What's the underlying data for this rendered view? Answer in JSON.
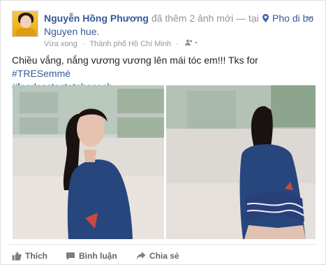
{
  "post": {
    "author": "Nguyễn Hồng Phương",
    "action_text": "đã thêm 2 ảnh mới —",
    "location_prefix": "tại",
    "location_line1": "Pho di bo",
    "location_line2": "Nguyen hue.",
    "time": "Vừa xong",
    "city": "Thành phố Hồ Chí Minh",
    "privacy_icon": "friends-icon",
    "caption_text": "Chiều vắng, nắng vương vương lên mái tóc em!!! Tks for ",
    "hashtag1": "#TRESemmé",
    "hashtag2": "#fearlesstoctetphacach"
  },
  "actions": {
    "like": "Thích",
    "comment": "Bình luận",
    "share": "Chia sẻ"
  },
  "colors": {
    "link": "#365899",
    "muted": "#90949c",
    "action": "#606770"
  }
}
